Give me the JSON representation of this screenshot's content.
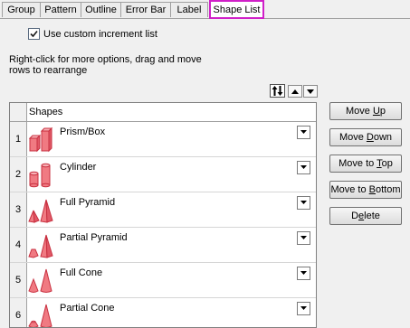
{
  "tabs": [
    {
      "label": "Group"
    },
    {
      "label": "Pattern"
    },
    {
      "label": "Outline"
    },
    {
      "label": "Error Bar"
    },
    {
      "label": "Label"
    },
    {
      "label": "Shape List",
      "active": true
    }
  ],
  "options": {
    "custom_increment_label": "Use custom increment list",
    "custom_increment_checked": true
  },
  "hint": {
    "line1": "Right-click for more options, drag and move",
    "line2": "rows to  rearrange"
  },
  "grid": {
    "column_header": "Shapes",
    "rows": [
      {
        "num": "1",
        "name": "Prism/Box",
        "icon": "prism-box-icon"
      },
      {
        "num": "2",
        "name": "Cylinder",
        "icon": "cylinder-icon"
      },
      {
        "num": "3",
        "name": "Full Pyramid",
        "icon": "full-pyramid-icon"
      },
      {
        "num": "4",
        "name": "Partial Pyramid",
        "icon": "partial-pyramid-icon"
      },
      {
        "num": "5",
        "name": "Full Cone",
        "icon": "full-cone-icon"
      },
      {
        "num": "6",
        "name": "Partial Cone",
        "icon": "partial-cone-icon"
      }
    ]
  },
  "buttons": {
    "move_up": {
      "pre": "Move ",
      "acc": "U",
      "post": "p"
    },
    "move_down": {
      "pre": "Move ",
      "acc": "D",
      "post": "own"
    },
    "move_top": {
      "pre": "Move to ",
      "acc": "T",
      "post": "op"
    },
    "move_bottom": {
      "pre": "Move to ",
      "acc": "B",
      "post": "ottom"
    },
    "delete": {
      "pre": "D",
      "acc": "e",
      "post": "lete"
    }
  },
  "colors": {
    "active_tab_border": "#d020c8",
    "shape_fill": "#f07a82",
    "shape_stroke": "#c83040"
  }
}
